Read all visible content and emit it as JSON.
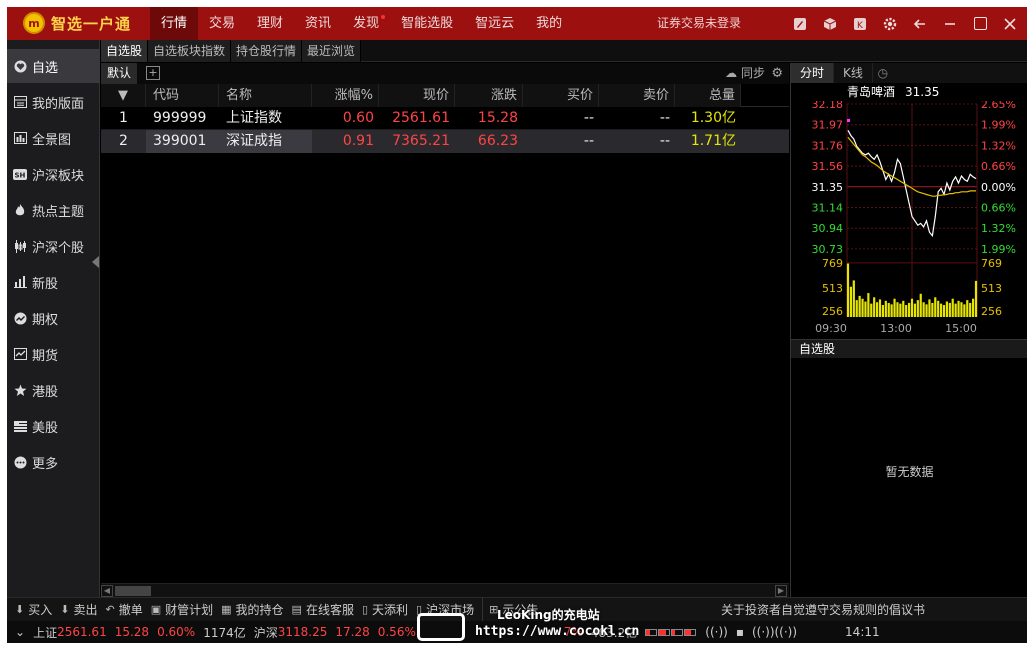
{
  "app": {
    "logo_text": "智选一户通",
    "logo_badge": "m",
    "login_status": "证券交易未登录"
  },
  "top_nav": [
    {
      "label": "行情",
      "active": true
    },
    {
      "label": "交易"
    },
    {
      "label": "理财"
    },
    {
      "label": "资讯"
    },
    {
      "label": "发现",
      "dot": true
    },
    {
      "label": "智能选股"
    },
    {
      "label": "智远云"
    },
    {
      "label": "我的"
    }
  ],
  "sidebar": {
    "items": [
      {
        "label": "自选",
        "icon": "heart-icon",
        "active": true
      },
      {
        "label": "我的版面",
        "icon": "layout-icon"
      },
      {
        "label": "全景图",
        "icon": "panorama-icon"
      },
      {
        "label": "沪深板块",
        "icon": "sh-board-icon"
      },
      {
        "label": "热点主题",
        "icon": "flame-icon"
      },
      {
        "label": "沪深个股",
        "icon": "candlestick-icon"
      },
      {
        "label": "新股",
        "icon": "bar-chart-icon"
      },
      {
        "label": "期权",
        "icon": "trend-icon"
      },
      {
        "label": "期货",
        "icon": "line-chart-icon"
      },
      {
        "label": "港股",
        "icon": "bauhinia-icon"
      },
      {
        "label": "美股",
        "icon": "flag-icon"
      },
      {
        "label": "更多",
        "icon": "more-icon"
      }
    ]
  },
  "sub_tabs": [
    "自选股",
    "自选板块指数",
    "持仓股行情",
    "最近浏览"
  ],
  "group": {
    "name": "默认",
    "add": "+",
    "sync": "同步"
  },
  "table": {
    "headers": [
      "",
      "代码",
      "名称",
      "涨幅%",
      "现价",
      "涨跌",
      "买价",
      "卖价",
      "总量"
    ],
    "rows": [
      {
        "idx": "1",
        "code": "999999",
        "name": "上证指数",
        "pct": "0.60",
        "price": "2561.61",
        "chg": "15.28",
        "bid": "--",
        "ask": "--",
        "vol": "1.30亿"
      },
      {
        "idx": "2",
        "code": "399001",
        "name": "深证成指",
        "pct": "0.91",
        "price": "7365.21",
        "chg": "66.23",
        "bid": "--",
        "ask": "--",
        "vol": "1.71亿"
      }
    ]
  },
  "right_panel": {
    "tabs": [
      "分时",
      "K线"
    ],
    "stock_name": "青岛啤酒",
    "stock_price": "31.35",
    "price_ticks": [
      "32.18",
      "31.97",
      "31.76",
      "31.56",
      "31.35",
      "31.14",
      "30.94",
      "30.73"
    ],
    "pct_ticks": [
      "2.65%",
      "1.99%",
      "1.32%",
      "0.66%",
      "0.00%",
      "0.66%",
      "1.32%",
      "1.99%"
    ],
    "vol_ticks": [
      "769",
      "513",
      "256"
    ],
    "time_ticks": [
      "09:30",
      "13:00",
      "15:00"
    ],
    "watch_title": "自选股",
    "empty_text": "暂无数据"
  },
  "chart_data": {
    "type": "line",
    "title": "",
    "series": [
      {
        "name": "",
        "values": [
          31.88,
          31.82,
          31.78,
          31.7,
          31.66,
          31.62,
          31.6,
          31.62,
          31.58,
          31.55,
          31.6,
          31.52,
          31.42,
          31.32,
          31.38,
          31.3,
          31.4,
          31.55,
          31.5,
          31.35,
          31.2,
          31.05,
          30.9,
          30.85,
          30.8,
          30.82,
          30.78,
          30.85,
          30.72,
          30.68,
          30.9,
          31.18,
          31.22,
          31.15,
          31.28,
          31.2,
          31.3,
          31.35,
          31.28,
          31.36,
          31.32,
          31.3,
          31.38,
          31.35,
          31.33
        ]
      },
      {
        "name": "",
        "values": [
          31.8,
          31.76,
          31.72,
          31.68,
          31.64,
          31.6,
          31.58,
          31.55,
          31.52,
          31.5,
          31.48,
          31.45,
          31.42,
          31.4,
          31.38,
          31.36,
          31.34,
          31.32,
          31.3,
          31.28,
          31.26,
          31.24,
          31.22,
          31.2,
          31.18,
          31.17,
          31.16,
          31.15,
          31.14,
          31.13,
          31.13,
          31.14,
          31.14,
          31.15,
          31.15,
          31.16,
          31.16,
          31.17,
          31.17,
          31.18,
          31.18,
          31.18,
          31.19,
          31.19,
          31.19
        ]
      }
    ],
    "volume": [
      760,
      430,
      520,
      240,
      300,
      260,
      220,
      340,
      190,
      280,
      210,
      250,
      170,
      230,
      200,
      180,
      260,
      210,
      190,
      230,
      170,
      200,
      260,
      190,
      240,
      330,
      210,
      180,
      250,
      200,
      280,
      230,
      190,
      170,
      220,
      200,
      260,
      190,
      230,
      210,
      180,
      240,
      200,
      260,
      513
    ],
    "ylim": [
      30.53,
      32.18
    ],
    "vol_max": 769
  },
  "toolbar": {
    "items": [
      {
        "label": "买入",
        "icon": "buy-icon"
      },
      {
        "label": "卖出",
        "icon": "sell-icon"
      },
      {
        "label": "撤单",
        "icon": "undo-icon"
      },
      {
        "label": "财管计划",
        "icon": "plan-icon"
      },
      {
        "label": "我的持仓",
        "icon": "holding-icon"
      },
      {
        "label": "在线客服",
        "icon": "service-icon"
      },
      {
        "label": "天添利",
        "icon": "wallet-icon"
      },
      {
        "label": "沪深市场",
        "icon": "market-icon"
      },
      {
        "label": "示公告",
        "icon": "add-icon"
      }
    ],
    "notice": "关于投资者自觉遵守交易规则的倡议书"
  },
  "status_bar": {
    "sh_label": "上证",
    "sh_price": "2561.61",
    "sh_chg": "15.28",
    "sh_pct": "0.60%",
    "sh_amount": "1174亿",
    "sz_label": "沪深",
    "sz_price": "3118.25",
    "sz_chg": "17.28",
    "sz_pct": "0.56%",
    "extra_pct": "7%",
    "amount2": "483.2亿",
    "time": "14:11"
  },
  "watermark": {
    "line1": "LeoKing的充电站",
    "line2": "https://www.cocokl.cn"
  },
  "colors": {
    "title_bar": "#9c1010",
    "up": "#ff4444",
    "volume": "#e6e600",
    "avg_line": "#e6c000"
  }
}
